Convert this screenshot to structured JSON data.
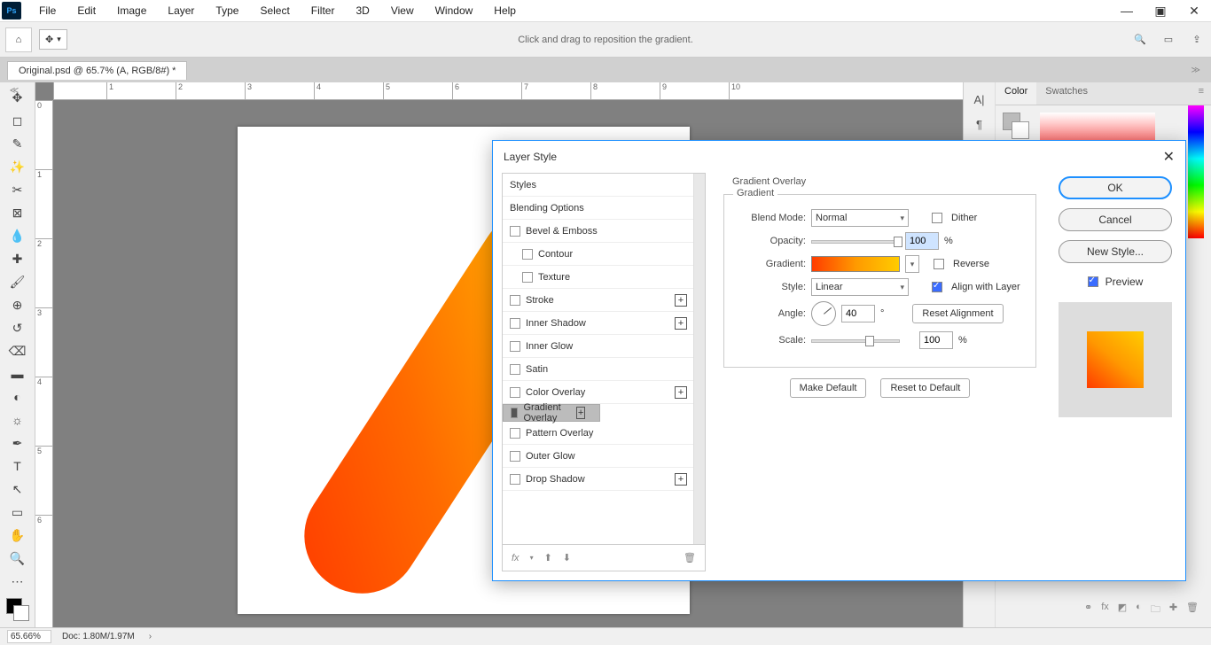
{
  "menu": {
    "items": [
      "File",
      "Edit",
      "Image",
      "Layer",
      "Type",
      "Select",
      "Filter",
      "3D",
      "View",
      "Window",
      "Help"
    ]
  },
  "optbar": {
    "hint": "Click and drag to reposition the gradient."
  },
  "document": {
    "tab": "Original.psd @ 65.7% (A, RGB/8#) *"
  },
  "ruler_h": [
    "1",
    "2",
    "3",
    "4",
    "5",
    "6",
    "7",
    "8",
    "9",
    "10"
  ],
  "ruler_v": [
    "0",
    "1",
    "2",
    "3",
    "4",
    "5",
    "6"
  ],
  "status": {
    "zoom": "65.66%",
    "doc": "Doc: 1.80M/1.97M"
  },
  "rightpanel": {
    "tabs": [
      "Color",
      "Swatches"
    ]
  },
  "dialog": {
    "title": "Layer Style",
    "styles_header": "Styles",
    "styles": [
      {
        "label": "Blending Options",
        "cb": false,
        "plus": false,
        "indent": 0,
        "hideCb": true
      },
      {
        "label": "Bevel & Emboss",
        "cb": false,
        "plus": false,
        "indent": 0
      },
      {
        "label": "Contour",
        "cb": false,
        "plus": false,
        "indent": 1
      },
      {
        "label": "Texture",
        "cb": false,
        "plus": false,
        "indent": 1
      },
      {
        "label": "Stroke",
        "cb": false,
        "plus": true,
        "indent": 0
      },
      {
        "label": "Inner Shadow",
        "cb": false,
        "plus": true,
        "indent": 0
      },
      {
        "label": "Inner Glow",
        "cb": false,
        "plus": false,
        "indent": 0
      },
      {
        "label": "Satin",
        "cb": false,
        "plus": false,
        "indent": 0
      },
      {
        "label": "Color Overlay",
        "cb": false,
        "plus": true,
        "indent": 0
      },
      {
        "label": "Gradient Overlay",
        "cb": true,
        "plus": true,
        "indent": 0,
        "selected": true
      },
      {
        "label": "Pattern Overlay",
        "cb": false,
        "plus": false,
        "indent": 0
      },
      {
        "label": "Outer Glow",
        "cb": false,
        "plus": false,
        "indent": 0
      },
      {
        "label": "Drop Shadow",
        "cb": false,
        "plus": true,
        "indent": 0
      }
    ],
    "section_title": "Gradient Overlay",
    "group_title": "Gradient",
    "blend_mode_label": "Blend Mode:",
    "blend_mode": "Normal",
    "dither_label": "Dither",
    "opacity_label": "Opacity:",
    "opacity": "100",
    "opacity_unit": "%",
    "gradient_label": "Gradient:",
    "reverse_label": "Reverse",
    "style_label": "Style:",
    "style": "Linear",
    "align_label": "Align with Layer",
    "angle_label": "Angle:",
    "angle": "40",
    "angle_unit": "°",
    "reset_align": "Reset Alignment",
    "scale_label": "Scale:",
    "scale": "100",
    "scale_unit": "%",
    "make_default": "Make Default",
    "reset_default": "Reset to Default",
    "ok": "OK",
    "cancel": "Cancel",
    "new_style": "New Style...",
    "preview_label": "Preview"
  }
}
